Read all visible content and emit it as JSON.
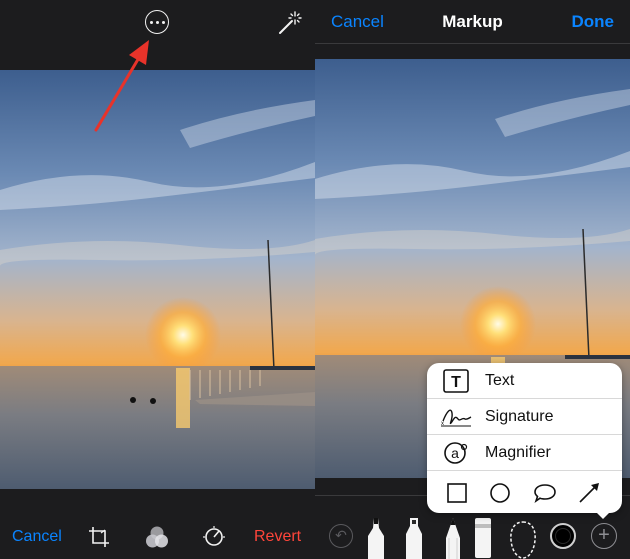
{
  "left_panel": {
    "top_icons": {
      "more": "more-options-icon",
      "auto_enhance": "magic-wand-icon"
    },
    "bottom_bar": {
      "cancel": "Cancel",
      "revert": "Revert",
      "tools": [
        "crop-icon",
        "filters-icon",
        "adjust-icon"
      ]
    },
    "annotation": "red-arrow-icon"
  },
  "right_panel": {
    "nav": {
      "cancel": "Cancel",
      "title": "Markup",
      "done": "Done"
    },
    "popover": {
      "items": [
        {
          "label": "Text",
          "icon": "text-box-icon"
        },
        {
          "label": "Signature",
          "icon": "signature-icon"
        },
        {
          "label": "Magnifier",
          "icon": "magnifier-icon"
        }
      ],
      "shapes": [
        "square-shape-icon",
        "circle-shape-icon",
        "speech-bubble-shape-icon",
        "arrow-shape-icon"
      ]
    },
    "toolbar": [
      "undo-icon",
      "pen-icon",
      "highlighter-icon",
      "pencil-icon",
      "eraser-icon",
      "lasso-icon",
      "color-picker-icon",
      "add-icon"
    ]
  },
  "colors": {
    "accent": "#0a84ff",
    "destructive": "#ff453a",
    "annotation": "#e8332a",
    "bar": "#1c1c1e"
  }
}
